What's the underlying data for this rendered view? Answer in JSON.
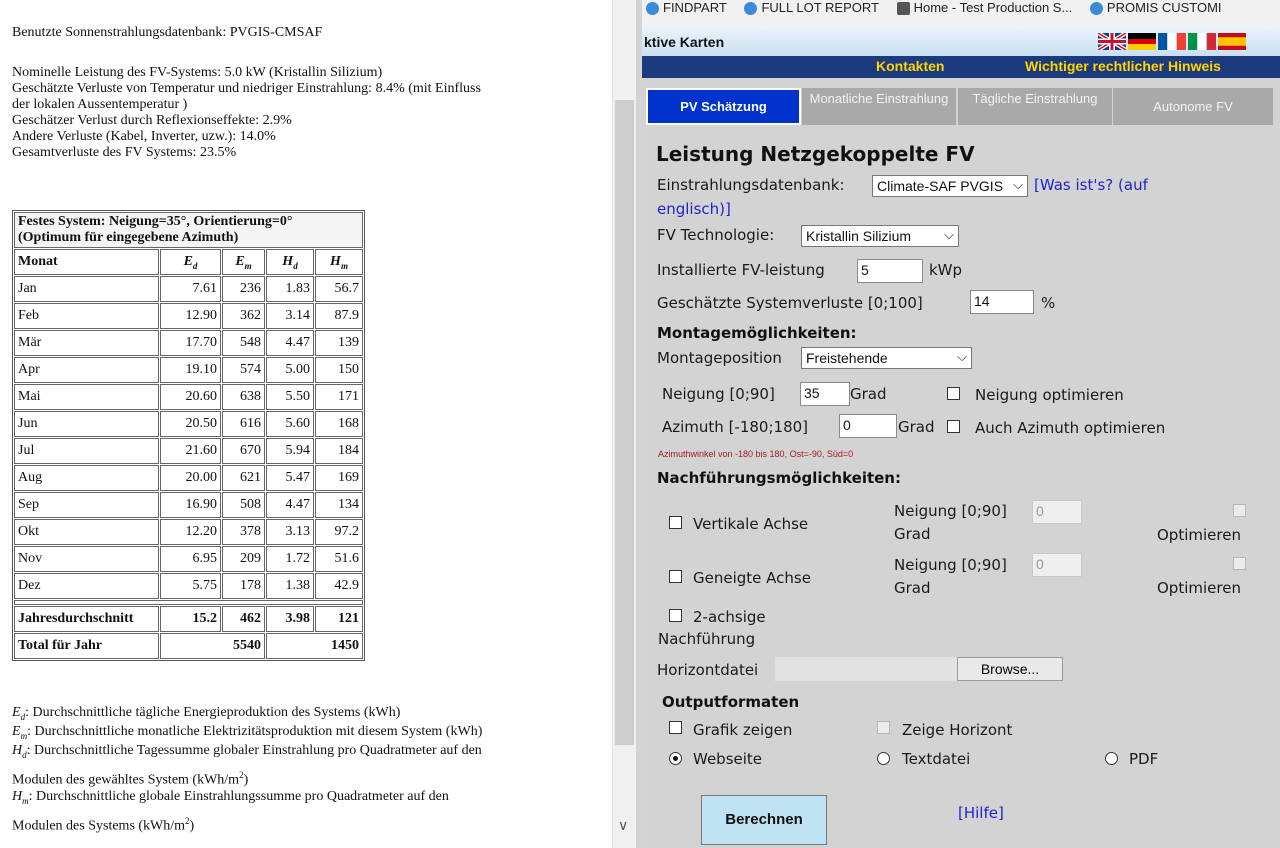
{
  "report": {
    "db_line": "Benutzte Sonnenstrahlungsdatenbank: PVGIS-CMSAF",
    "nominal_power": "Nominelle Leistung des FV-Systems: 5.0 kW (Kristallin Silizium)",
    "temp_loss_1": "Geschätzte Verluste von Temperatur und niedriger Einstrahlung: 8.4% (mit Einfluss",
    "temp_loss_2": "der lokalen Aussentemperatur )",
    "refl_loss": "Geschätzer Verlust durch Reflexionseffekte: 2.9%",
    "other_loss": "Andere Verluste (Kabel, Inverter, uzw.): 14.0%",
    "total_loss": "Gesamtverluste des FV Systems: 23.5%",
    "table": {
      "title_1": "Festes System: Neigung=35°, Orientierung=0°",
      "title_2": "(Optimum für eingegebene Azimuth)",
      "headers": [
        "Monat",
        "E",
        "E",
        "H",
        "H"
      ],
      "header_subs": [
        "",
        "d",
        "m",
        "d",
        "m"
      ],
      "rows": [
        [
          "Jan",
          "7.61",
          "236",
          "1.83",
          "56.7"
        ],
        [
          "Feb",
          "12.90",
          "362",
          "3.14",
          "87.9"
        ],
        [
          "Mär",
          "17.70",
          "548",
          "4.47",
          "139"
        ],
        [
          "Apr",
          "19.10",
          "574",
          "5.00",
          "150"
        ],
        [
          "Mai",
          "20.60",
          "638",
          "5.50",
          "171"
        ],
        [
          "Jun",
          "20.50",
          "616",
          "5.60",
          "168"
        ],
        [
          "Jul",
          "21.60",
          "670",
          "5.94",
          "184"
        ],
        [
          "Aug",
          "20.00",
          "621",
          "5.47",
          "169"
        ],
        [
          "Sep",
          "16.90",
          "508",
          "4.47",
          "134"
        ],
        [
          "Okt",
          "12.20",
          "378",
          "3.13",
          "97.2"
        ],
        [
          "Nov",
          "6.95",
          "209",
          "1.72",
          "51.6"
        ],
        [
          "Dez",
          "5.75",
          "178",
          "1.38",
          "42.9"
        ]
      ],
      "avg": [
        "Jahresdurchschnitt",
        "15.2",
        "462",
        "3.98",
        "121"
      ],
      "total": [
        "Total für Jahr",
        "5540",
        "1450"
      ]
    },
    "legend": {
      "ed_sym": "E",
      "ed_sub": "d",
      "ed_text": ": Durchschnittliche tägliche Energieproduktion des Systems (kWh)",
      "em_sym": "E",
      "em_sub": "m",
      "em_text": ": Durchschnittliche monatliche Elektrizitätsproduktion mit diesem System (kWh)",
      "hd_sym": "H",
      "hd_sub": "d",
      "hd_text": ": Durchschnittliche Tagessumme globaler Einstrahlung pro Quadratmeter auf den",
      "hd_text2": "Modulen des gewähltes System (kWh/m",
      "hd_sup": "2",
      "hd_close": ")",
      "hm_sym": "H",
      "hm_sub": "m",
      "hm_text": ": Durchschnittliche globale Einstrahlungssumme pro Quadratmeter auf den",
      "hm_text2": "Modulen des Systems (kWh/m",
      "hm_sup": "2",
      "hm_close": ")"
    }
  },
  "bookmarks": [
    "FINDPART",
    "FULL LOT REPORT",
    "Home - Test Production S...",
    "PROMIS CUSTOMI"
  ],
  "app": {
    "title": "ktive Karten",
    "nav_contacts": "Kontakten",
    "nav_legal": "Wichtiger rechtlicher Hinweis",
    "tabs": [
      "PV Schätzung",
      "Monatliche Einstrahlung",
      "Tägliche Einstrahlung",
      "Autonome FV"
    ],
    "heading": "Leistung Netzgekoppelte FV",
    "db_label": "Einstrahlungsdatenbank:",
    "db_value": "Climate-SAF PVGIS",
    "db_link_1": "[Was ist's? (auf",
    "db_link_2": "englisch)]",
    "tech_label": "FV Technologie:",
    "tech_value": "Kristallin Silizium",
    "power_label": "Installierte FV-leistung",
    "power_value": "5",
    "power_unit": "kWp",
    "loss_label": "Geschätzte Systemverluste [0;100]",
    "loss_value": "14",
    "loss_unit": "%",
    "mount_heading": "Montagemöglichkeiten:",
    "mount_pos_label": "Montageposition",
    "mount_pos_value": "Freistehende",
    "tilt_label": "Neigung [0;90]",
    "tilt_value": "35",
    "tilt_unit": "Grad",
    "tilt_opt": "Neigung optimieren",
    "azi_label": "Azimuth [-180;180]",
    "azi_value": "0",
    "azi_unit": "Grad",
    "azi_opt": "Auch Azimuth optimieren",
    "azi_hint": "Azimuthwinkel von -180 bis 180, Ost=-90, Süd=0",
    "track_heading": "Nachführungsmöglichkeiten:",
    "vert_axis": "Vertikale Achse",
    "incl_axis": "Geneigte Achse",
    "neig_label": "Neigung [0;90]",
    "neig_unit": "Grad",
    "neig_value": "0",
    "optimize": "Optimieren",
    "two_axis_1": "2-achsige",
    "two_axis_2": "Nachführung",
    "horizon_label": "Horizontdatei",
    "browse": "Browse...",
    "output_heading": "Outputformaten",
    "show_graph": "Grafik zeigen",
    "show_horizon": "Zeige Horizont",
    "out_web": "Webseite",
    "out_text": "Textdatei",
    "out_pdf": "PDF",
    "calc_button": "Berechnen",
    "help": "[Hilfe]"
  }
}
